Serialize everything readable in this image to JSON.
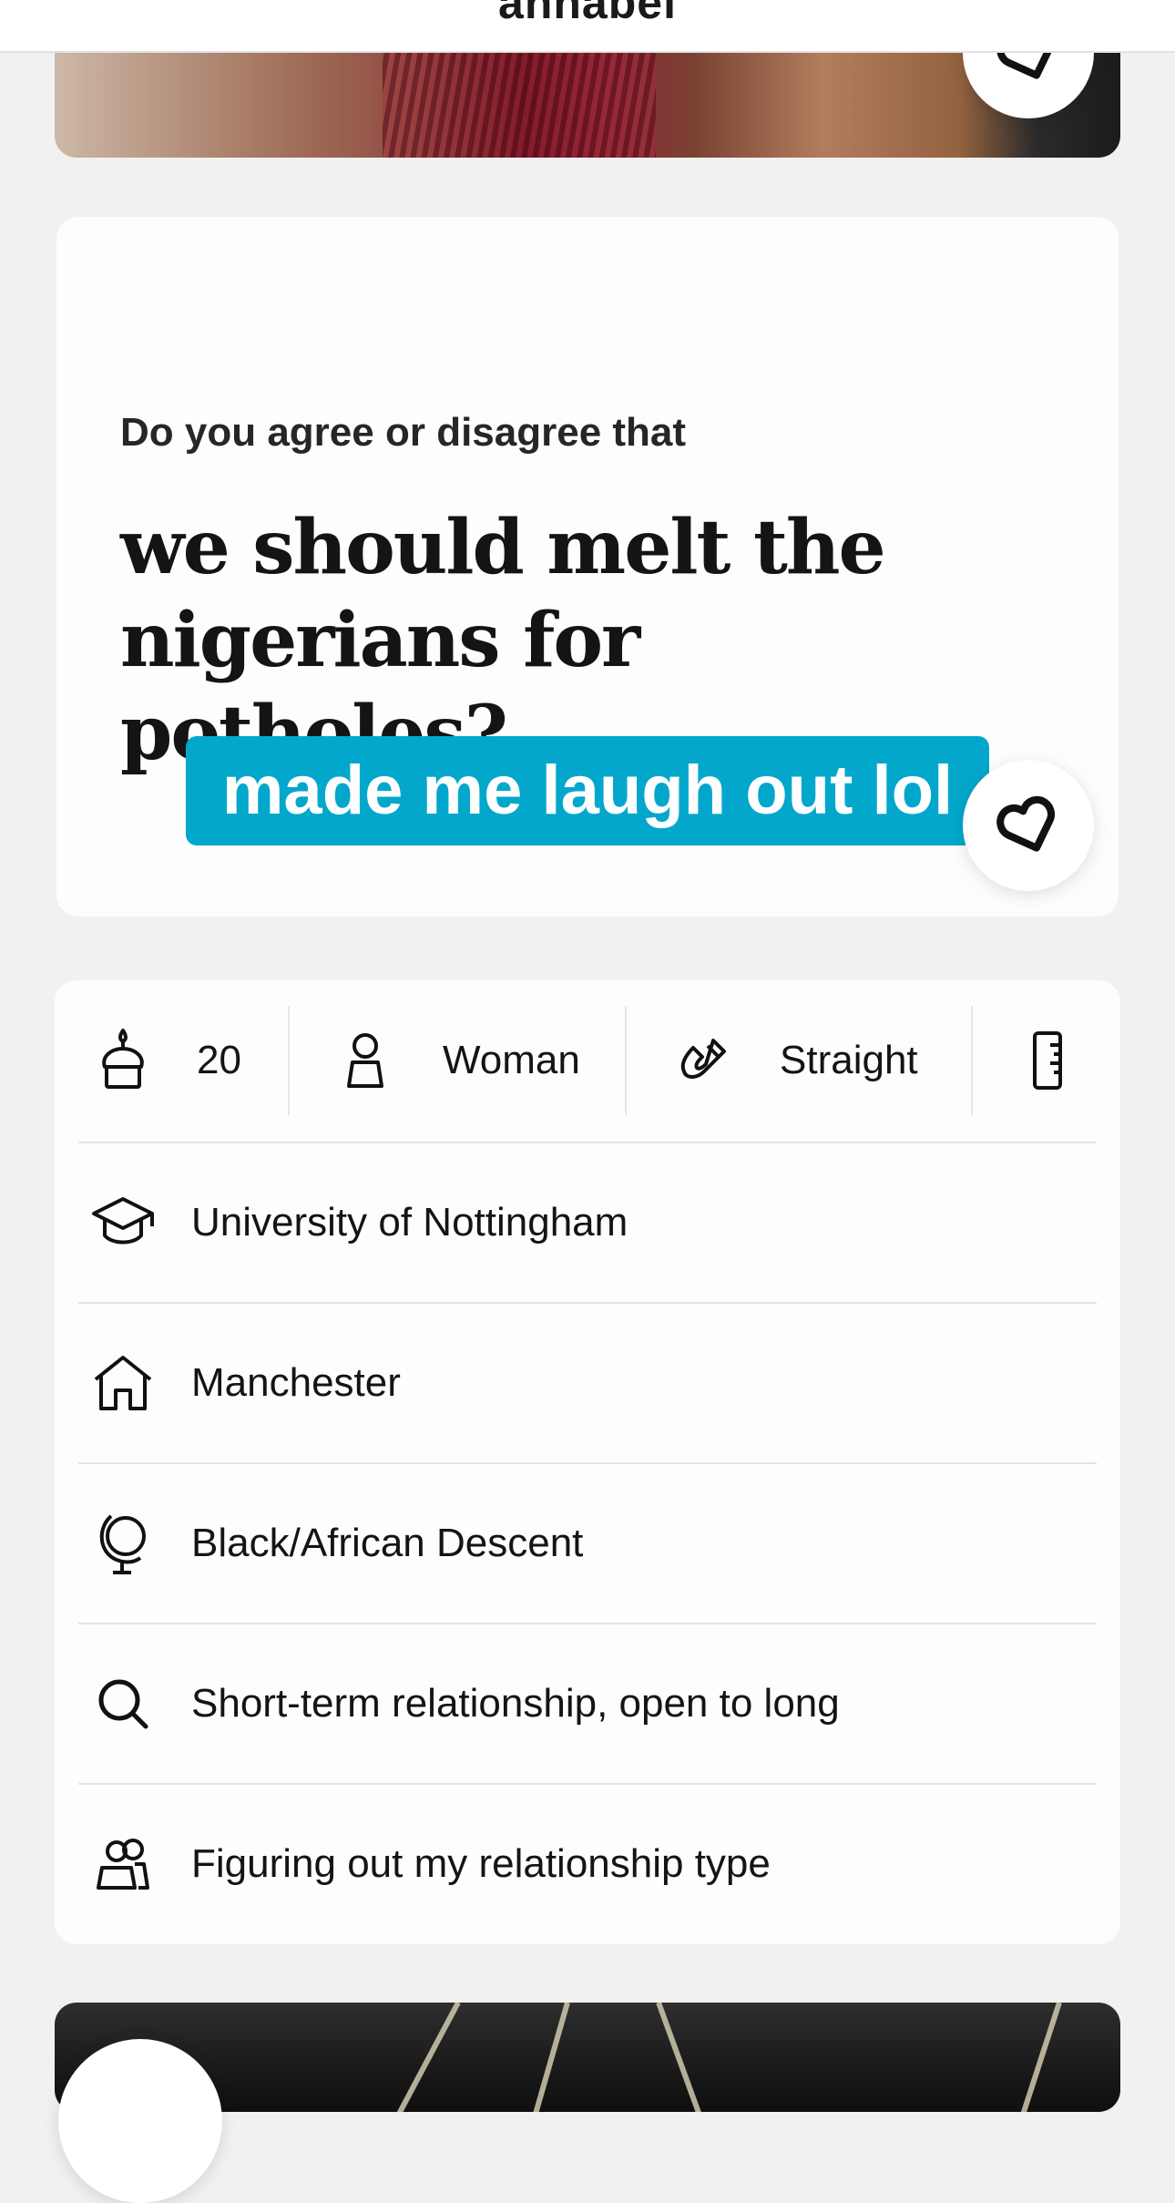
{
  "header": {
    "name": "annabel"
  },
  "prompt": {
    "label": "Do you agree or disagree that",
    "answer": "we should melt the nigerians for potholes?",
    "comment": "made me laugh out lol"
  },
  "stats": [
    {
      "icon": "birthday-cake-icon",
      "value": "20"
    },
    {
      "icon": "person-icon",
      "value": "Woman"
    },
    {
      "icon": "magnet-icon",
      "value": "Straight"
    },
    {
      "icon": "ruler-icon",
      "value": ""
    }
  ],
  "details": [
    {
      "icon": "graduation-cap-icon",
      "value": "University of Nottingham"
    },
    {
      "icon": "home-icon",
      "value": "Manchester"
    },
    {
      "icon": "globe-icon",
      "value": "Black/African Descent"
    },
    {
      "icon": "search-icon",
      "value": "Short-term relationship, open to long"
    },
    {
      "icon": "people-icon",
      "value": "Figuring out my relationship type"
    }
  ],
  "colors": {
    "accent": "#03a7cc",
    "background": "#f1f1f1",
    "card": "#fdfdfd"
  }
}
